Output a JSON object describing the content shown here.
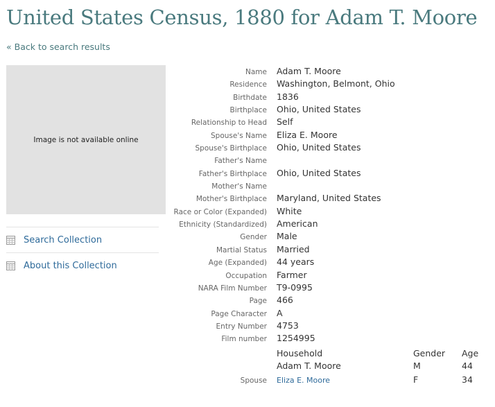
{
  "page": {
    "title": "United States Census, 1880 for Adam T. Moore",
    "back_link": "« Back to search results"
  },
  "image": {
    "message": "Image is not available online"
  },
  "sidebar": {
    "items": [
      {
        "label": "Search Collection",
        "icon": "calendar-grid-icon"
      },
      {
        "label": "About this Collection",
        "icon": "calendar-grid-icon"
      }
    ]
  },
  "record": [
    {
      "label": "Name",
      "value": "Adam T. Moore"
    },
    {
      "label": "Residence",
      "value": "Washington, Belmont, Ohio"
    },
    {
      "label": "Birthdate",
      "value": "1836"
    },
    {
      "label": "Birthplace",
      "value": "Ohio, United States"
    },
    {
      "label": "Relationship to Head",
      "value": "Self"
    },
    {
      "label": "Spouse's Name",
      "value": "Eliza E. Moore"
    },
    {
      "label": "Spouse's Birthplace",
      "value": "Ohio, United States"
    },
    {
      "label": "Father's Name",
      "value": ""
    },
    {
      "label": "Father's Birthplace",
      "value": "Ohio, United States"
    },
    {
      "label": "Mother's Name",
      "value": ""
    },
    {
      "label": "Mother's Birthplace",
      "value": "Maryland, United States"
    },
    {
      "label": "Race or Color (Expanded)",
      "value": "White"
    },
    {
      "label": "Ethnicity (Standardized)",
      "value": "American"
    },
    {
      "label": "Gender",
      "value": "Male"
    },
    {
      "label": "Martial Status",
      "value": "Married"
    },
    {
      "label": "Age (Expanded)",
      "value": "44 years"
    },
    {
      "label": "Occupation",
      "value": "Farmer"
    },
    {
      "label": "NARA Film Number",
      "value": "T9-0995"
    },
    {
      "label": "Page",
      "value": "466"
    },
    {
      "label": "Page Character",
      "value": "A"
    },
    {
      "label": "Entry Number",
      "value": "4753"
    },
    {
      "label": "Film number",
      "value": "1254995"
    }
  ],
  "household": {
    "headers": {
      "name": "Household",
      "gender": "Gender",
      "age": "Age"
    },
    "rows": [
      {
        "role": "",
        "name": "Adam T. Moore",
        "gender": "M",
        "age": "44"
      },
      {
        "role": "Spouse",
        "name": "Eliza E. Moore",
        "gender": "F",
        "age": "34"
      }
    ]
  },
  "colors": {
    "title": "#4a7a7e",
    "link": "#2e6a9a",
    "image_placeholder": "#e2e2e2"
  }
}
